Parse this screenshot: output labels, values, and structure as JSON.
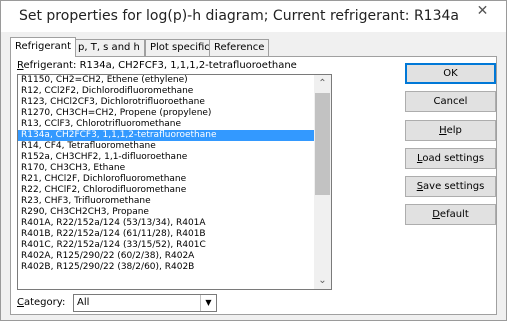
{
  "window": {
    "title": "Set properties for log(p)-h diagram; Current refrigerant: R134a",
    "close_glyph": "✕"
  },
  "tabs": [
    {
      "label": "Refrigerant"
    },
    {
      "label": "p, T, s and h"
    },
    {
      "label": "Plot specific"
    },
    {
      "label": "Reference"
    }
  ],
  "refrigerant_label": {
    "key": "R",
    "rest": "efrigerant:  R134a, CH2FCF3, 1,1,1,2-tetrafluoroethane"
  },
  "list": {
    "items": [
      "R1150, CH2=CH2, Ethene (ethylene)",
      "R12, CCl2F2, Dichlorodifluoromethane",
      "R123, CHCl2CF3, Dichlorotrifluoroethane",
      "R1270, CH3CH=CH2, Propene (propylene)",
      "R13, CClF3, Chlorotrifluoromethane",
      "R134a, CH2FCF3, 1,1,1,2-tetrafluoroethane",
      "R14, CF4, Tetrafluoromethane",
      "R152a, CH3CHF2, 1,1-difluoroethane",
      "R170, CH3CH3, Ethane",
      "R21, CHCl2F, Dichlorofluoromethane",
      "R22, CHClF2, Chlorodifluoromethane",
      "R23, CHF3, Trifluoromethane",
      "R290, CH3CH2CH3, Propane",
      "R401A, R22/152a/124 (53/13/34), R401A",
      "R401B, R22/152a/124 (61/11/28), R401B",
      "R401C, R22/152a/124 (33/15/52), R401C",
      "R402A, R125/290/22 (60/2/38), R402A",
      "R402B, R125/290/22 (38/2/60), R402B"
    ],
    "selected_index": 5,
    "scroll_up_glyph": "⌃",
    "scroll_down_glyph": "⌄"
  },
  "category": {
    "key": "C",
    "rest": "ategory:",
    "value": "All",
    "dropdown_glyph": "▼"
  },
  "buttons": {
    "ok": "OK",
    "cancel": "Cancel",
    "help": {
      "key": "H",
      "rest": "elp"
    },
    "load": {
      "key": "L",
      "rest": "oad settings"
    },
    "save": {
      "key": "S",
      "rest": "ave settings"
    },
    "default": {
      "key": "D",
      "rest": "efault"
    }
  }
}
